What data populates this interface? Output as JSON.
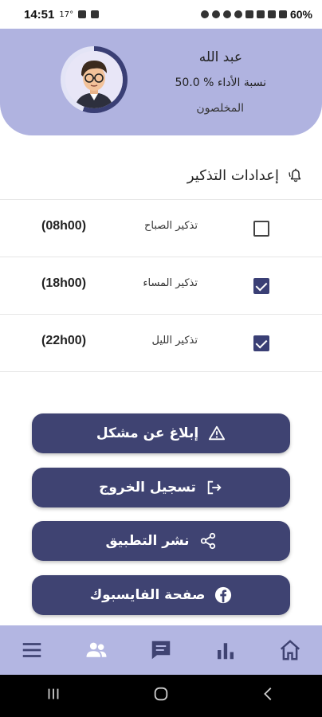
{
  "status": {
    "time": "14:51",
    "temp": "17°",
    "battery": "60%"
  },
  "user": {
    "name": "عبد الله",
    "performance": "نسبة الأداء % 50.0",
    "group": "المخلصون"
  },
  "reminders": {
    "title": "إعدادات التذكير",
    "items": [
      {
        "label": "تذكير الصباح",
        "time": "(08h00)",
        "checked": false
      },
      {
        "label": "تذكير المساء",
        "time": "(18h00)",
        "checked": true
      },
      {
        "label": "تذكير الليل",
        "time": "(22h00)",
        "checked": true
      }
    ]
  },
  "actions": {
    "report": "إبلاغ عن مشكل",
    "logout": "تسجيل الخروج",
    "share": "نشر التطبيق",
    "facebook": "صفحة الفايسبوك"
  },
  "colors": {
    "primary": "#3f4372",
    "header": "#b0b3e0",
    "nav": "#b3b6e2"
  },
  "icons": {
    "bottom_nav": [
      "menu-icon",
      "users-icon",
      "chat-icon",
      "stats-icon",
      "home-icon"
    ],
    "system_nav": [
      "recents-icon",
      "home-circle-icon",
      "back-icon"
    ]
  }
}
